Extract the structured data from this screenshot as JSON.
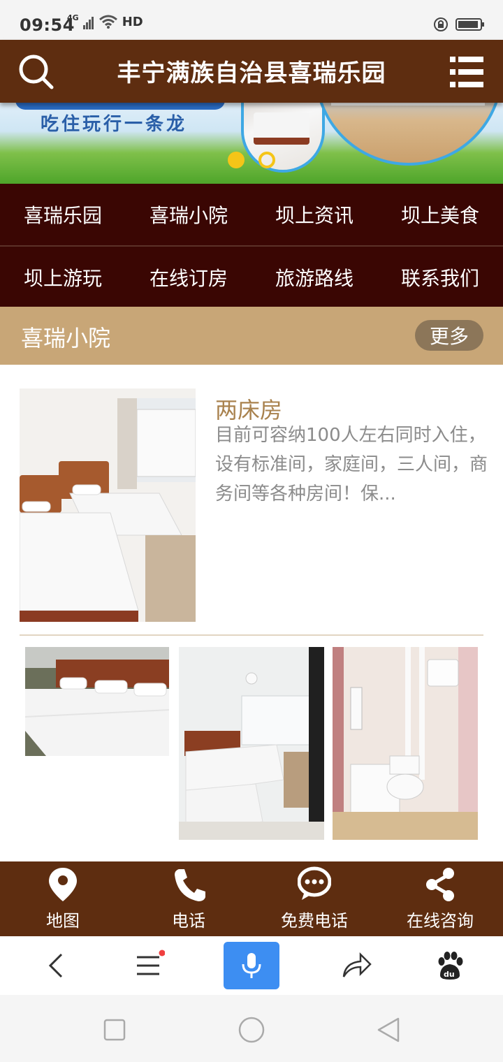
{
  "status_bar": {
    "time": "09:54",
    "network": "4G",
    "hd": "HD"
  },
  "header": {
    "title": "丰宁满族自治县喜瑞乐园"
  },
  "banner": {
    "slogan": "吃住玩行一条龙"
  },
  "nav": {
    "row1": [
      "喜瑞乐园",
      "喜瑞小院",
      "坝上资讯",
      "坝上美食"
    ],
    "row2": [
      "坝上游玩",
      "在线订房",
      "旅游路线",
      "联系我们"
    ]
  },
  "section": {
    "title": "喜瑞小院",
    "more": "更多"
  },
  "featured": {
    "title": "两床房",
    "description": "目前可容纳100人左右同时入住，设有标准间，家庭间，三人间，商务间等各种房间！保..."
  },
  "contact_bar": {
    "map": "地图",
    "phone": "电话",
    "free_call": "免费电话",
    "online": "在线咨询"
  },
  "colors": {
    "header_bg": "#5e2d10",
    "nav_bg": "#3a0603",
    "section_bg": "#c8a677",
    "accent_title": "#a9824e",
    "mic_blue": "#3d8ef2"
  }
}
